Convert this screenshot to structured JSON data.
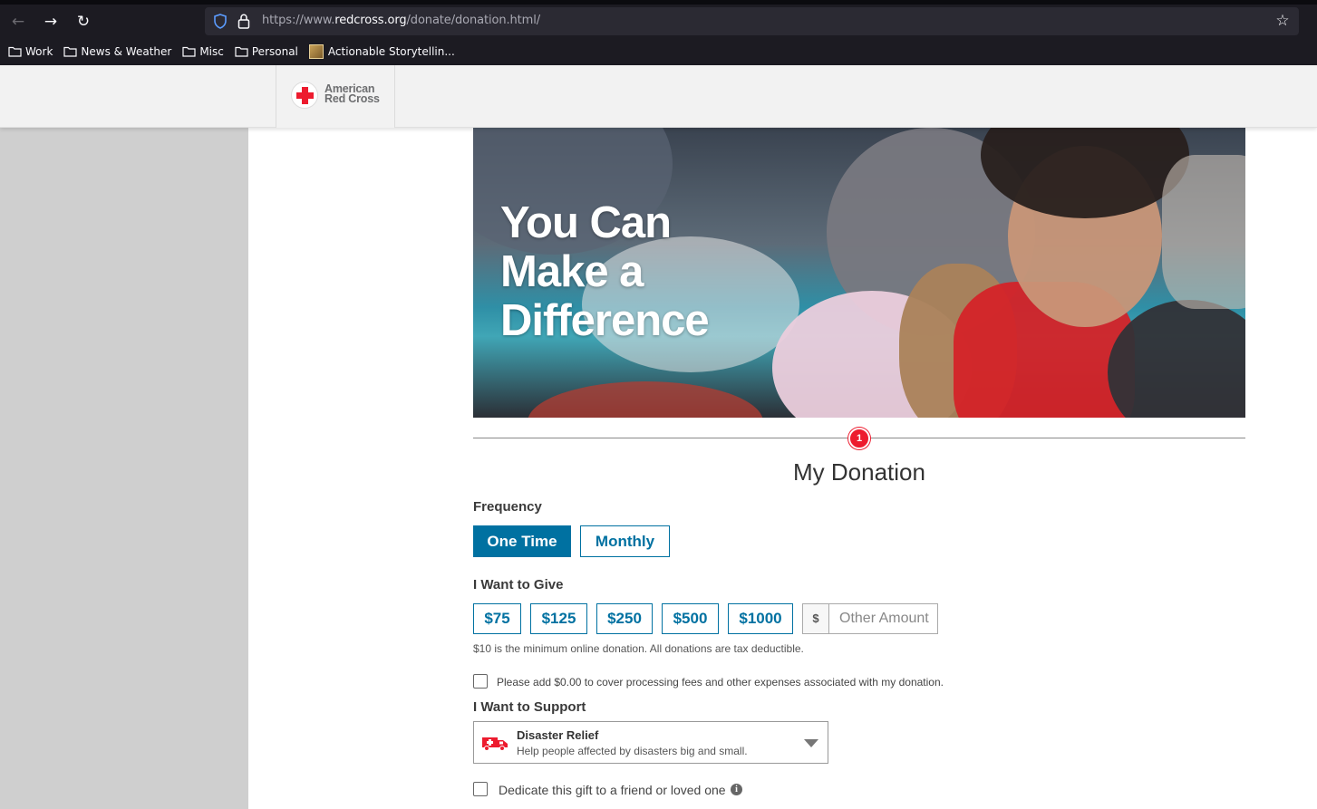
{
  "browser": {
    "url_prefix": "https://www.",
    "url_host": "redcross.org",
    "url_path": "/donate/donation.html/",
    "back_icon": "arrow-left",
    "forward_icon": "arrow-right",
    "reload_icon": "reload",
    "bookmark_star_icon": "star",
    "bookmarks": [
      {
        "label": "Work",
        "icon": "folder"
      },
      {
        "label": "News & Weather",
        "icon": "folder"
      },
      {
        "label": "Misc",
        "icon": "folder"
      },
      {
        "label": "Personal",
        "icon": "folder"
      },
      {
        "label": "Actionable Storytellin...",
        "icon": "favicon"
      }
    ]
  },
  "header": {
    "logo_line1": "American",
    "logo_line2": "Red Cross"
  },
  "hero": {
    "title_line1": "You Can",
    "title_line2": "Make a",
    "title_line3": "Difference"
  },
  "step": {
    "number": "1",
    "title": "My Donation"
  },
  "frequency": {
    "label": "Frequency",
    "options": [
      "One Time",
      "Monthly"
    ],
    "selected": "One Time"
  },
  "give": {
    "label": "I Want to Give",
    "amounts": [
      "$75",
      "$125",
      "$250",
      "$500",
      "$1000"
    ],
    "currency_symbol": "$",
    "other_placeholder": "Other Amount",
    "note": "$10 is the minimum online donation. All donations are tax deductible."
  },
  "fees": {
    "label": "Please add $0.00 to cover processing fees and other expenses associated with my donation.",
    "checked": false
  },
  "support": {
    "label": "I Want to Support",
    "selected_title": "Disaster Relief",
    "selected_desc": "Help people affected by disasters big and small.",
    "icon": "ambulance"
  },
  "dedicate": {
    "label": "Dedicate this gift to a friend or loved one",
    "checked": false
  },
  "colors": {
    "primary_blue": "#0071a1",
    "red": "#ed1b2e"
  }
}
